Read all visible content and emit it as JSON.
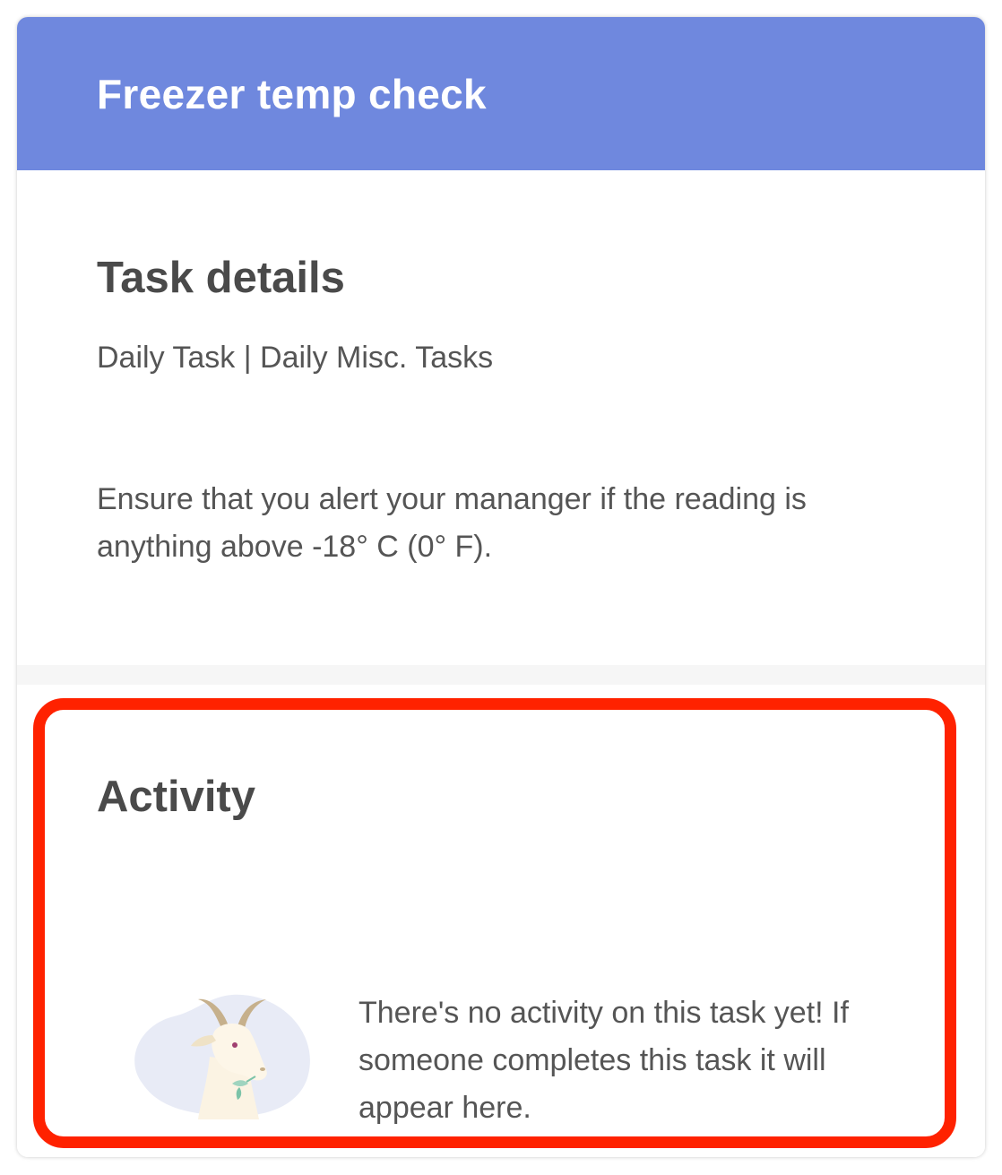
{
  "header": {
    "title": "Freezer temp check"
  },
  "task_details": {
    "heading": "Task details",
    "meta": "Daily Task | Daily Misc. Tasks",
    "description": "Ensure that you alert your mananger if the reading is anything above -18° C (0° F)."
  },
  "activity": {
    "heading": "Activity",
    "empty_message": "There's no activity on this task yet! If someone completes this task it will appear here.",
    "illustration_icon": "goat-illustration"
  },
  "colors": {
    "header_background": "#6f88de",
    "header_text": "#ffffff",
    "body_text": "#555555",
    "heading_text": "#4a4a4a",
    "highlight_frame": "#ff2200"
  }
}
